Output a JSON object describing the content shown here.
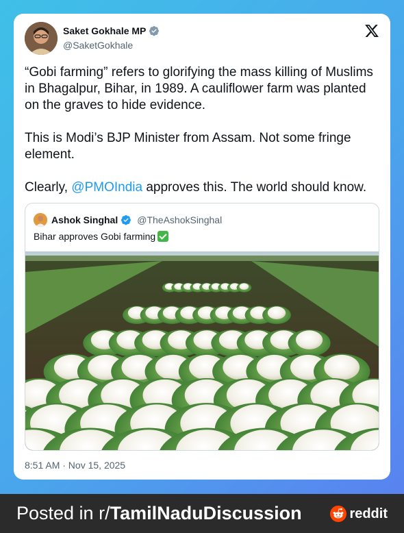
{
  "tweet": {
    "author_name": "Saket Gokhale MP",
    "author_handle": "@SaketGokhale",
    "text_part1": "“Gobi farming” refers to glorifying the mass killing of Muslims in Bhagalpur, Bihar, in 1989. A cauliflower farm was planted on the graves to hide evidence.\n\nThis is Modi’s BJP Minister from Assam. Not some fringe element.\n\nClearly, ",
    "mention": "@PMOIndia",
    "text_part2": " approves this. The world should know.",
    "timestamp": "8:51 AM · Nov 15, 2025"
  },
  "quote": {
    "author_name": "Ashok Singhal",
    "author_handle": "@TheAshokSinghal",
    "text": "Bihar approves Gobi farming"
  },
  "footer": {
    "prefix": "Posted in r/",
    "subreddit": "TamilNaduDiscussion",
    "brand": "reddit"
  },
  "colors": {
    "verified": "#1d9bf0",
    "link": "#1d9bf0",
    "reddit": "#ff4500"
  },
  "icons": [
    "x-logo-icon",
    "verified-badge-icon",
    "check-mark-emoji-icon",
    "reddit-logo-icon"
  ]
}
